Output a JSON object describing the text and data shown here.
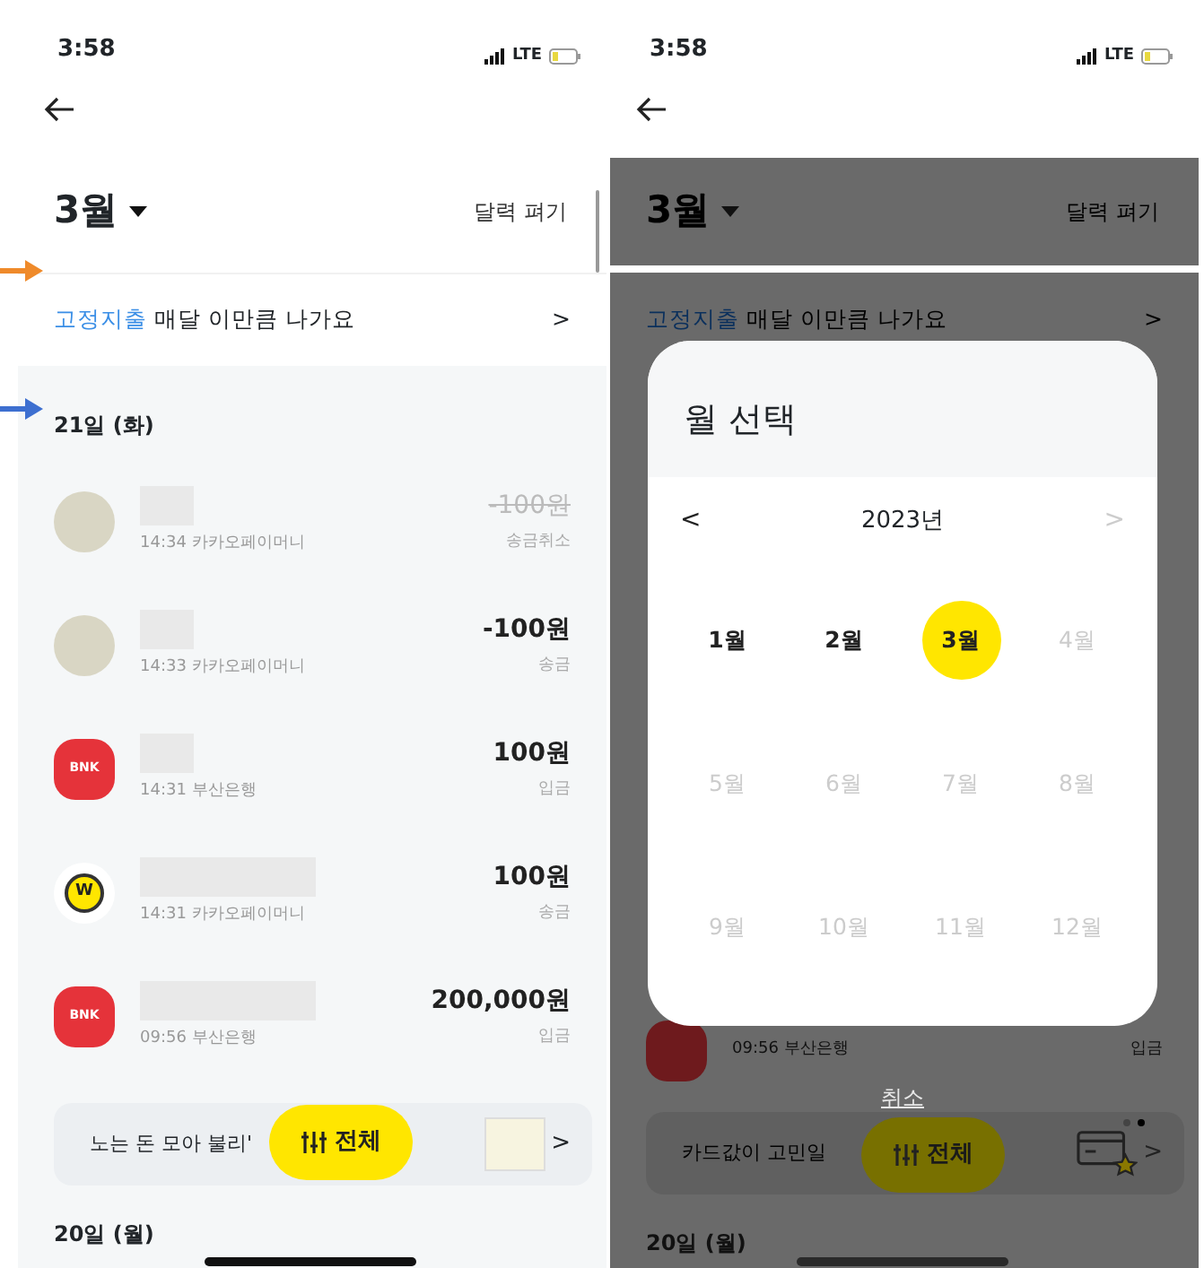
{
  "annotations": [
    {
      "kind": "arrow",
      "color": "#ef8a2a"
    },
    {
      "kind": "arrow",
      "color": "#3d6fd0"
    }
  ],
  "screens": [
    {
      "dimmed": false,
      "status_bar": {
        "time": "3:58",
        "network": "LTE"
      },
      "header": {
        "month": "3월",
        "calendar_toggle": "달력 펴기"
      },
      "fixed_expense": {
        "text": "**고정지출** 매달 이만큼 나가요",
        "chevron": ">"
      },
      "scrollbar": true,
      "day_heading": "21일 (화)",
      "transactions": [
        {
          "kind": "avatar",
          "name_hidden": true,
          "time": "14:34",
          "source": "카카오페이머니",
          "amount": "-100원",
          "type": "송금취소",
          "cancelled": true
        },
        {
          "kind": "avatar",
          "name_hidden": true,
          "time": "14:33",
          "source": "카카오페이머니",
          "amount": "-100원",
          "type": "송금",
          "cancelled": false
        },
        {
          "kind": "bank",
          "logo_text": "BNK",
          "name_hidden": true,
          "time": "14:31",
          "source": "부산은행",
          "amount": "100원",
          "type": "입금",
          "cancelled": false
        },
        {
          "kind": "coin",
          "logo_text": "W",
          "name_hidden": true,
          "time": "14:31",
          "source": "카카오페이머니",
          "amount": "100원",
          "type": "송금",
          "cancelled": false
        },
        {
          "kind": "bank",
          "logo_text": "BNK",
          "name_hidden": true,
          "time": "09:56",
          "source": "부산은행",
          "amount": "200,000원",
          "type": "입금",
          "cancelled": false
        }
      ],
      "banner": {
        "kind": "promo",
        "text": "노는 돈 모아 불리'",
        "chevron": ">"
      },
      "filter_button": "전체",
      "next_day_heading": "20일 (월)"
    },
    {
      "dimmed": true,
      "status_bar": {
        "time": "3:58",
        "network": "LTE"
      },
      "header": {
        "month": "3월",
        "calendar_toggle": "달력 펴기"
      },
      "fixed_expense": {
        "text": "**고정지출** 매달 이만큼 나가요",
        "chevron": ">"
      },
      "scrollbar": false,
      "transactions": [
        {
          "kind": "bank",
          "time": "09:56",
          "source": "부산은행",
          "type": "입금"
        }
      ],
      "modal": {
        "title": "월 선택",
        "prev": "<",
        "year": "2023년",
        "next": ">",
        "next_disabled": true,
        "months": [
          {
            "label": "1월",
            "selected": false,
            "disabled": false
          },
          {
            "label": "2월",
            "selected": false,
            "disabled": false
          },
          {
            "label": "3월",
            "selected": true,
            "disabled": false
          },
          {
            "label": "4월",
            "selected": false,
            "disabled": true
          },
          {
            "label": "5월",
            "selected": false,
            "disabled": true
          },
          {
            "label": "6월",
            "selected": false,
            "disabled": true
          },
          {
            "label": "7월",
            "selected": false,
            "disabled": true
          },
          {
            "label": "8월",
            "selected": false,
            "disabled": true
          },
          {
            "label": "9월",
            "selected": false,
            "disabled": true
          },
          {
            "label": "10월",
            "selected": false,
            "disabled": true
          },
          {
            "label": "11월",
            "selected": false,
            "disabled": true
          },
          {
            "label": "12월",
            "selected": false,
            "disabled": true
          }
        ],
        "cancel": "취소"
      },
      "banner": {
        "kind": "card-star",
        "text": "카드값이 고민일 ",
        "chevron": ">",
        "page_dots": [
          {
            "selected": false
          },
          {
            "selected": true
          }
        ]
      },
      "filter_button": "전체",
      "next_day_heading": "20일 (월)"
    }
  ]
}
